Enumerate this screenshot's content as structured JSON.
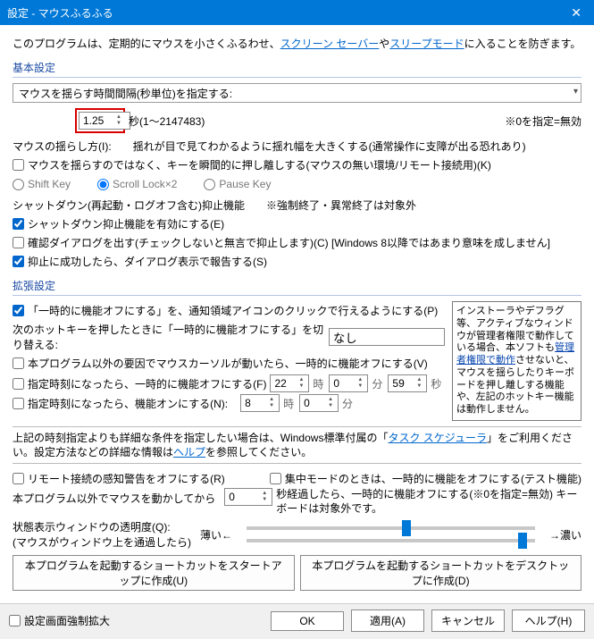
{
  "window": {
    "title": "設定 - マウスふるふる"
  },
  "intro": {
    "pre": "このプログラムは、定期的にマウスを小さくふるわせ、",
    "link1": "スクリーン セーバー",
    "mid": "や",
    "link2": "スリープモード",
    "post": "に入ることを防ぎます。"
  },
  "groups": {
    "basic": "基本設定",
    "ext": "拡張設定"
  },
  "basic": {
    "interval_combo": "マウスを揺らす時間間隔(秒単位)を指定する:",
    "interval_value": "1.25",
    "interval_unit_range": "秒(1～2147483)",
    "interval_note": "※0を指定=無効",
    "shake_method_label": "マウスの揺らし方(I):",
    "shake_method_desc": "揺れが目で見てわかるように揺れ幅を大きくする(通常操作に支障が出る恐れあり)",
    "no_shake_keypress": "マウスを揺らすのではなく、キーを瞬間的に押し離しする(マウスの無い環境/リモート接続用)(K)",
    "radios": {
      "shift": "Shift Key",
      "scroll": "Scroll Lock×2",
      "pause": "Pause Key"
    },
    "shutdown_header": "シャットダウン(再起動・ログオフ含む)抑止機能　　※強制終了・異常終了は対象外",
    "shutdown_enable": "シャットダウン抑止機能を有効にする(E)",
    "shutdown_confirm": "確認ダイアログを出す(チェックしないと無言で抑止します)(C) [Windows 8以降ではあまり意味を成しません]",
    "shutdown_report": "抑止に成功したら、ダイアログ表示で報告する(S)"
  },
  "ext": {
    "tray_toggle": "「一時的に機能オフにする」を、通知領域アイコンのクリックで行えるようにする(P)",
    "hotkey_label": "次のホットキーを押したときに「一時的に機能オフにする」を切り替える:",
    "hotkey_value": "なし",
    "other_cursor": "本プログラム以外の要因でマウスカーソルが動いたら、一時的に機能オフにする(V)",
    "time_off_label": "指定時刻になったら、一時的に機能オフにする(F)",
    "time_on_label": "指定時刻になったら、機能オンにする(N):",
    "off_h": "22",
    "off_m": "0",
    "off_s": "59",
    "on_h": "8",
    "on_m": "0",
    "unit_h": "時",
    "unit_m": "分",
    "unit_s": "秒",
    "sched_note_pre": "上記の時刻指定よりも詳細な条件を指定したい場合は、Windows標準付属の「",
    "sched_link": "タスク スケジューラ",
    "sched_note_mid": "」をご利用ください。設定方法などの詳細な情報は",
    "help_link": "ヘルプ",
    "sched_note_post": "を参照してください。",
    "remote_warn": "リモート接続の感知警告をオフにする(R)",
    "focus_mode": "集中モードのときは、一時的に機能をオフにする(テスト機能)",
    "idle_label": "本プログラム以外でマウスを動かしてから",
    "idle_value": "0",
    "idle_note": "秒経過したら、一時的に機能オフにする(※0を指定=無効) キーボードは対象外です。",
    "opacity_label": "状態表示ウィンドウの透明度(Q):",
    "opacity_sub": "(マウスがウィンドウ上を通過したら)",
    "scale_left": "薄い←",
    "scale_right": "→濃い",
    "btn_startup": "本プログラムを起動するショートカットをスタートアップに作成(U)",
    "btn_desktop": "本プログラムを起動するショートカットをデスクトップに作成(D)"
  },
  "infobox": {
    "l1": "インストーラやデフラグ等、アクティブなウィンドウが管理者権限で動作している場合、本ソフトも",
    "link": "管理者権限で動作",
    "l2": "させないと、マウスを揺らしたりキーボードを押し離しする機能や、左記のホットキー機能は動作しません。"
  },
  "footer": {
    "force_expand": "設定画面強制拡大",
    "ok": "OK",
    "apply": "適用(A)",
    "cancel": "キャンセル",
    "help": "ヘルプ(H)"
  }
}
